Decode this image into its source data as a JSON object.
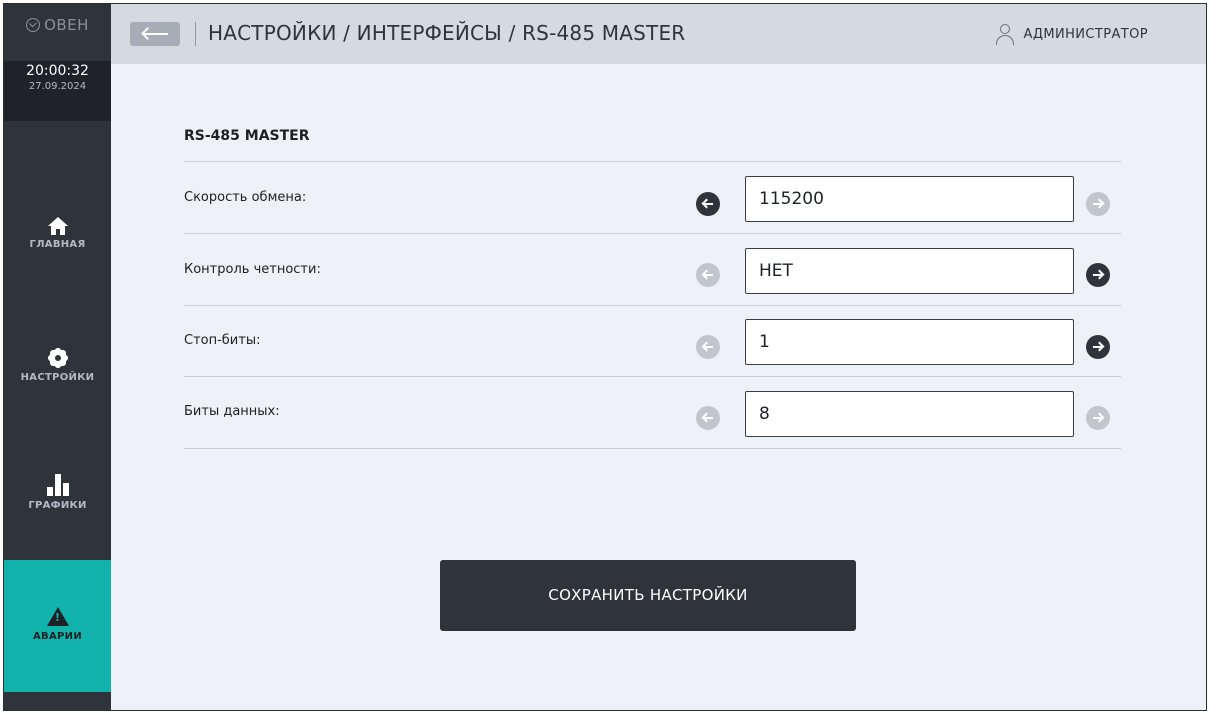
{
  "brand": {
    "name": "ОВЕН",
    "icon": "owen-logo-icon"
  },
  "clock": {
    "time": "20:00:32",
    "date": "27.09.2024"
  },
  "nav": [
    {
      "label": "ГЛАВНАЯ",
      "icon": "home-icon",
      "active": false
    },
    {
      "label": "НАСТРОЙКИ",
      "icon": "gear-icon",
      "active": false
    },
    {
      "label": "ГРАФИКИ",
      "icon": "bar-chart-icon",
      "active": false
    },
    {
      "label": "АВАРИИ",
      "icon": "warning-icon",
      "active": true
    }
  ],
  "header": {
    "breadcrumb": "НАСТРОЙКИ / ИНТЕРФЕЙСЫ / RS-485 MASTER",
    "user": "АДМИНИСТРАТОР",
    "back_icon": "arrow-left-icon",
    "user_icon": "user-icon"
  },
  "main": {
    "section_title": "RS-485 MASTER",
    "settings": [
      {
        "label": "Скорость обмена:",
        "value": "115200",
        "prev_enabled": true,
        "next_enabled": false
      },
      {
        "label": "Контроль четности:",
        "value": "НЕТ",
        "prev_enabled": false,
        "next_enabled": true
      },
      {
        "label": "Стоп-биты:",
        "value": "1",
        "prev_enabled": false,
        "next_enabled": true
      },
      {
        "label": "Биты данных:",
        "value": "8",
        "prev_enabled": false,
        "next_enabled": false
      }
    ],
    "save_label": "СОХРАНИТЬ НАСТРОЙКИ"
  },
  "colors": {
    "sidebar": "#2f343b",
    "accent": "#13b3ad",
    "header": "#d5dae1",
    "background": "#eef1f7"
  }
}
